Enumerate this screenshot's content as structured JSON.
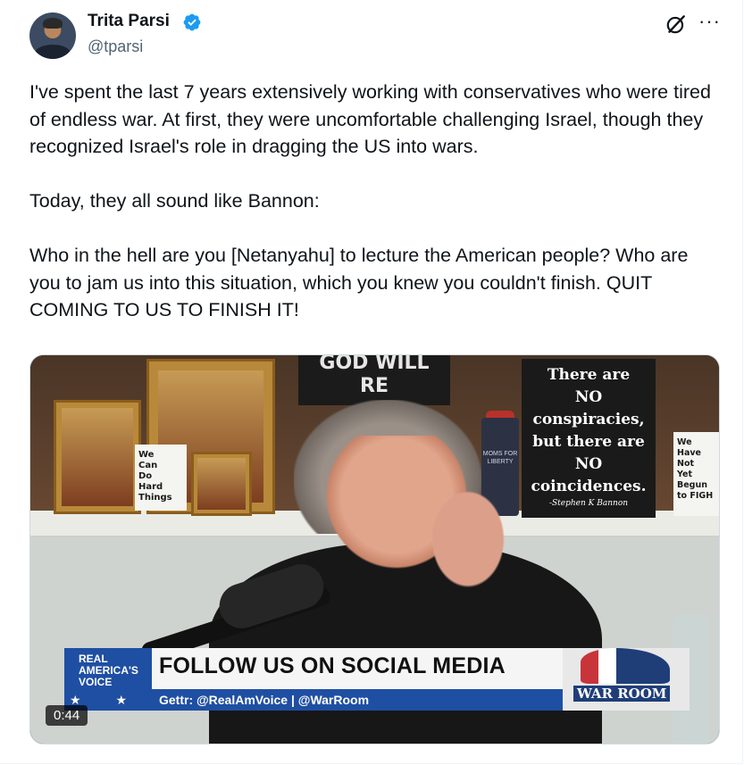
{
  "author": {
    "display_name": "Trita Parsi",
    "handle": "@tparsi",
    "verified": true,
    "verified_color": "#1d9bf0"
  },
  "header_icons": {
    "grok": "grok-icon",
    "more": "more-options-icon"
  },
  "tweet": {
    "text": "I've spent the last 7 years extensively working with conservatives who were tired of endless war. At first, they were uncomfortable challenging Israel, though they recognized Israel's role in dragging the US into wars.\n\nToday, they all sound like Bannon:\n\nWho in the hell are you [Netanyahu] to lecture the American people? Who are you to jam us into this situation, which you knew you couldn't finish. QUIT COMING TO US TO FINISH IT!"
  },
  "video": {
    "duration": "0:44",
    "scene": {
      "sign_lines": [
        "There are",
        "NO",
        "conspiracies,",
        "but there are",
        "NO",
        "coincidences."
      ],
      "sign_signature": "-Stephen K Bannon",
      "card_left": [
        "We",
        "Can",
        "Do",
        "Hard",
        "Things"
      ],
      "card_right": [
        "We",
        "Have",
        "Not",
        "Yet",
        "Begun",
        "to FIGH"
      ],
      "top_sign": [
        "GOD WILL",
        "RE"
      ],
      "mug_text": "MOMS FOR LIBERTY"
    },
    "banner": {
      "network": "REAL AMERICA'S VOICE",
      "headline": "FOLLOW US ON SOCIAL MEDIA",
      "subline": "Gettr: @RealAmVoice | @WarRoom",
      "show": "WAR ROOM"
    }
  }
}
